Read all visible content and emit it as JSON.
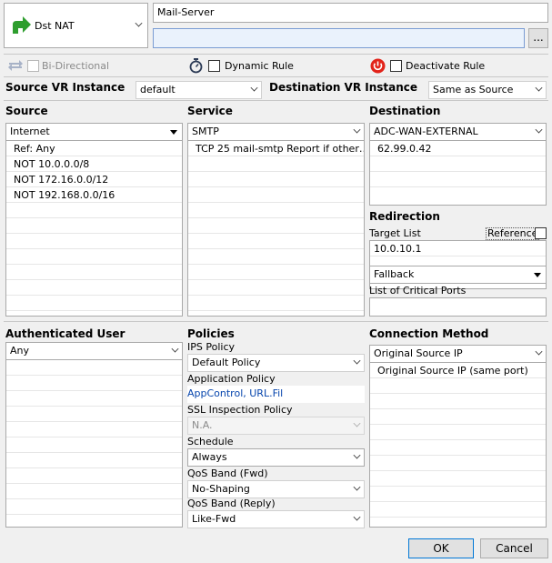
{
  "rule": {
    "action": "Dst NAT",
    "name": "Mail-Server",
    "description": "",
    "browse_button": "..."
  },
  "options": {
    "bidirectional": "Bi-Directional",
    "dynamic_rule": "Dynamic Rule",
    "deactivate_rule": "Deactivate Rule"
  },
  "vr": {
    "source_label": "Source VR Instance",
    "source_value": "default",
    "destination_label": "Destination VR Instance",
    "destination_value": "Same as Source"
  },
  "source": {
    "header": "Source",
    "selected": "Internet",
    "items": [
      "Ref: Any",
      "NOT 10.0.0.0/8",
      "NOT 172.16.0.0/12",
      "NOT 192.168.0.0/16"
    ]
  },
  "service": {
    "header": "Service",
    "selected": "SMTP",
    "items": [
      "TCP  25 mail-smtp  Report if other…"
    ]
  },
  "destination": {
    "header": "Destination",
    "selected": "ADC-WAN-EXTERNAL",
    "items": [
      "62.99.0.42"
    ]
  },
  "redirection": {
    "header": "Redirection",
    "target_list_label": "Target List",
    "reference_label": "Reference",
    "target_value": "10.0.10.1",
    "fallback": "Fallback",
    "critical_ports_label": "List of Critical Ports",
    "critical_ports_value": ""
  },
  "auth_user": {
    "header": "Authenticated User",
    "selected": "Any"
  },
  "policies": {
    "header": "Policies",
    "ips_label": "IPS Policy",
    "ips_value": "Default Policy",
    "app_label": "Application Policy",
    "app_value": "AppControl, URL.Fil",
    "ssl_label": "SSL Inspection Policy",
    "ssl_value": "N.A.",
    "schedule_label": "Schedule",
    "schedule_value": "Always",
    "qos_fwd_label": "QoS Band (Fwd)",
    "qos_fwd_value": "No-Shaping",
    "qos_reply_label": "QoS Band (Reply)",
    "qos_reply_value": "Like-Fwd"
  },
  "connection": {
    "header": "Connection Method",
    "selected": "Original Source IP",
    "items": [
      "Original Source IP (same port)"
    ]
  },
  "buttons": {
    "ok": "OK",
    "cancel": "Cancel"
  },
  "colors": {
    "accent_green": "#2e9e2e",
    "link_blue": "#0645ad",
    "deactivate_red": "#e2231a"
  }
}
